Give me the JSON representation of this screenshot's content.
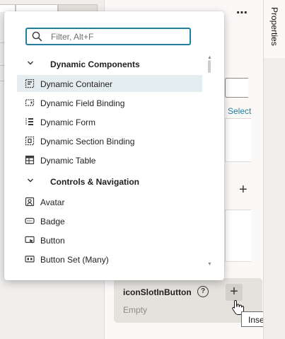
{
  "popup": {
    "search": {
      "placeholder": "Filter, Alt+F",
      "value": ""
    },
    "groups": [
      {
        "label": "Dynamic Components",
        "items": [
          {
            "label": "Dynamic Container",
            "icon": "dynamic-container-icon",
            "selected": true
          },
          {
            "label": "Dynamic Field Binding",
            "icon": "dynamic-field-binding-icon"
          },
          {
            "label": "Dynamic Form",
            "icon": "dynamic-form-icon"
          },
          {
            "label": "Dynamic Section Binding",
            "icon": "dynamic-section-binding-icon"
          },
          {
            "label": "Dynamic Table",
            "icon": "dynamic-table-icon"
          }
        ]
      },
      {
        "label": "Controls & Navigation",
        "items": [
          {
            "label": "Avatar",
            "icon": "avatar-icon"
          },
          {
            "label": "Badge",
            "icon": "badge-icon"
          },
          {
            "label": "Button",
            "icon": "button-icon"
          },
          {
            "label": "Button Set (Many)",
            "icon": "button-set-icon"
          }
        ]
      }
    ]
  },
  "panel": {
    "select_link": "Select",
    "slot": {
      "title": "iconSlotInButton",
      "empty_text": "Empty"
    },
    "tooltip": "Insert Con"
  },
  "right_rail": {
    "tab_label": "Properties"
  },
  "colors": {
    "accent": "#227e9e",
    "selected_row": "#e4edf0",
    "slot_card": "#e5e2de"
  }
}
